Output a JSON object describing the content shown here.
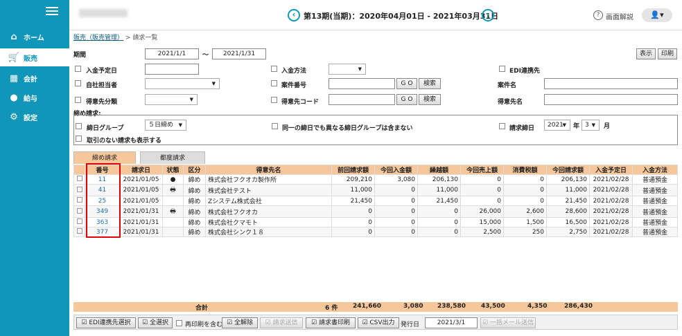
{
  "nav": {
    "items": [
      {
        "label": "ホーム",
        "icon": "home-icon"
      },
      {
        "label": "販売",
        "icon": "cart-icon"
      },
      {
        "label": "会計",
        "icon": "calculator-icon"
      },
      {
        "label": "給与",
        "icon": "money-bag-icon"
      },
      {
        "label": "設定",
        "icon": "gear-icon"
      }
    ]
  },
  "header": {
    "period": "第13期(当期)：2020年04月01日 - 2021年03月31日",
    "help": "画面解説"
  },
  "breadcrumb": {
    "parent": "販売（販売管理）",
    "sep": ">",
    "current": "請求一覧"
  },
  "filters": {
    "period_label": "期間",
    "date_from": "2021/1/1",
    "tilde": "～",
    "date_to": "2021/1/31",
    "show": "表示",
    "print": "印刷",
    "due_label": "入金予定日",
    "payment_method": "入金方法",
    "edi": "EDI連携先",
    "self_staff": "自社担当者",
    "case_no": "案件番号",
    "case_name": "案件名",
    "customer_class": "得意先分類",
    "customer_code": "得意先コード",
    "customer_name": "得意先名",
    "go": "G O",
    "search": "検索",
    "closing_label": "締め請求:",
    "closing_group": "締日グループ",
    "closing_group_value": "５日締め",
    "same_day": "同一の締日でも異なる締日グループは含まない",
    "closing_day": "請求締日",
    "year_value": "2021",
    "year_unit": "年",
    "month_value": "3",
    "month_unit": "月",
    "include_no_tx": "取引のない請求も表示する"
  },
  "tabs": [
    "締め請求",
    "都度請求"
  ],
  "table": {
    "headers": [
      "番号",
      "請求日",
      "状態",
      "区分",
      "得意先名",
      "前回請求額",
      "今回入金額",
      "繰越額",
      "今回売上額",
      "消費税額",
      "今回請求額",
      "入金予定日",
      "入金方法"
    ],
    "rows": [
      {
        "no": "11",
        "date": "2021/01/05",
        "status": "●",
        "kind": "締め",
        "customer": "株式会社フクオカ製作所",
        "prev": "209,210",
        "paid": "3,080",
        "carry": "206,130",
        "sales": "0",
        "tax": "0",
        "amount": "206,130",
        "due": "2021/02/28",
        "method": "普通預金"
      },
      {
        "no": "41",
        "date": "2021/01/05",
        "status": "🖶",
        "kind": "締め",
        "customer": "株式会社テスト",
        "prev": "11,000",
        "paid": "0",
        "carry": "11,000",
        "sales": "0",
        "tax": "0",
        "amount": "11,000",
        "due": "2021/02/28",
        "method": "普通預金"
      },
      {
        "no": "25",
        "date": "2021/01/05",
        "status": "",
        "kind": "締め",
        "customer": "Zシステム株式会社",
        "prev": "21,450",
        "paid": "0",
        "carry": "21,450",
        "sales": "0",
        "tax": "0",
        "amount": "21,450",
        "due": "2021/02/28",
        "method": "普通預金"
      },
      {
        "no": "349",
        "date": "2021/01/31",
        "status": "🖶",
        "kind": "締め",
        "customer": "株式会社フクオカ",
        "prev": "0",
        "paid": "0",
        "carry": "0",
        "sales": "26,000",
        "tax": "2,600",
        "amount": "28,600",
        "due": "2021/02/28",
        "method": "普通預金"
      },
      {
        "no": "363",
        "date": "2021/01/31",
        "status": "",
        "kind": "締め",
        "customer": "株式会社クマモト",
        "prev": "0",
        "paid": "0",
        "carry": "0",
        "sales": "15,000",
        "tax": "1,500",
        "amount": "16,500",
        "due": "2021/02/28",
        "method": "普通預金"
      },
      {
        "no": "377",
        "date": "2021/01/31",
        "status": "",
        "kind": "締め",
        "customer": "株式会社シンク１８",
        "prev": "0",
        "paid": "0",
        "carry": "0",
        "sales": "2,500",
        "tax": "250",
        "amount": "2,750",
        "due": "2021/02/28",
        "method": "普通預金"
      }
    ]
  },
  "totals": {
    "label": "合計",
    "count": "6 件",
    "prev": "241,660",
    "paid": "3,080",
    "carry": "238,580",
    "sales": "43,500",
    "tax": "4,350",
    "amount": "286,430"
  },
  "bottom": {
    "edi_select": "EDI連携先選択",
    "select_all": "全選択",
    "reprint": "再印刷を含む",
    "deselect": "全解除",
    "send": "請求送信",
    "print_inv": "請求書印刷",
    "csv": "CSV出力",
    "issue_label": "発行日",
    "issue_date": "2021/3/1",
    "bulk_mail": "一括メール送信"
  }
}
